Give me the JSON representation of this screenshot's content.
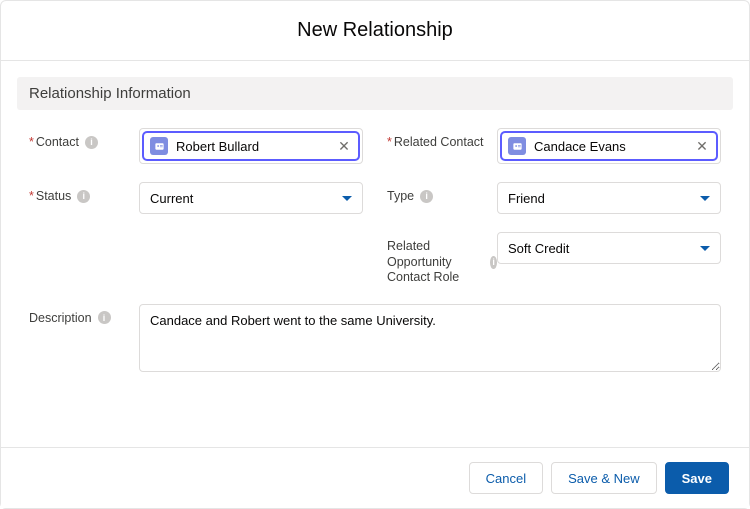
{
  "header": {
    "title": "New Relationship"
  },
  "section": {
    "title": "Relationship Information"
  },
  "fields": {
    "contact": {
      "label": "Contact",
      "required": true,
      "value": "Robert Bullard"
    },
    "related_contact": {
      "label": "Related Contact",
      "required": true,
      "value": "Candace Evans"
    },
    "status": {
      "label": "Status",
      "required": true,
      "value": "Current"
    },
    "type": {
      "label": "Type",
      "required": false,
      "value": "Friend"
    },
    "related_occ_role": {
      "label": "Related Opportunity Contact Role",
      "required": false,
      "value": "Soft Credit"
    },
    "description": {
      "label": "Description",
      "required": false,
      "value": "Candace and Robert went to the same University."
    }
  },
  "footer": {
    "cancel": "Cancel",
    "save_new": "Save & New",
    "save": "Save"
  }
}
